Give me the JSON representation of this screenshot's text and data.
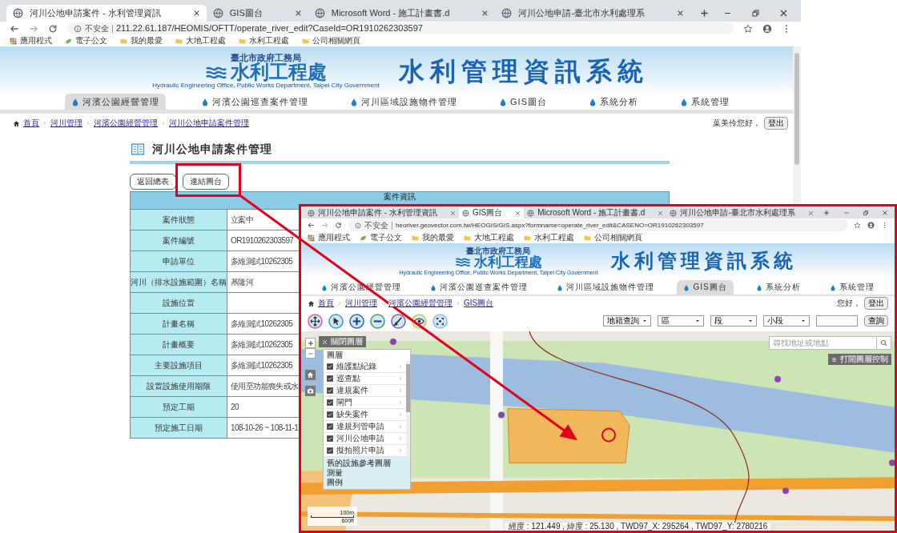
{
  "background_window": {
    "tabs": [
      {
        "title": "河川公地申請案件 - 水利管理資訊",
        "selected": true
      },
      {
        "title": "GIS圖台",
        "selected": false
      },
      {
        "title": "Microsoft Word - 施工計畫書.d",
        "selected": false
      },
      {
        "title": "河川公地申請-臺北市水利處理系",
        "selected": false
      }
    ],
    "address": {
      "security": "不安全",
      "url": "211.22.61.187/HEOMIS/OFTT/operate_river_edit?CaseId=OR1910262303597"
    },
    "bookmarks": [
      {
        "label": "應用程式",
        "kind": "apps"
      },
      {
        "label": "電子公文",
        "kind": "leaf"
      },
      {
        "label": "我的最愛",
        "kind": "folder"
      },
      {
        "label": "大地工程處",
        "kind": "folder"
      },
      {
        "label": "水利工程處",
        "kind": "folder"
      },
      {
        "label": "公司相關網頁",
        "kind": "folder"
      }
    ],
    "header": {
      "agency": "臺北市政府工務局",
      "office": "水利工程處",
      "office_en": "Hydraulic Engineering Office, Public Works Department, Taipei City Government",
      "system_title": "水利管理資訊系統"
    },
    "nav": [
      {
        "label": "河濱公園經營管理",
        "selected": true
      },
      {
        "label": "河濱公園巡查案件管理",
        "selected": false
      },
      {
        "label": "河川區域設施物件管理",
        "selected": false
      },
      {
        "label": "GIS圖台",
        "selected": false
      },
      {
        "label": "系統分析",
        "selected": false
      },
      {
        "label": "系統管理",
        "selected": false
      }
    ],
    "breadcrumb": [
      "首頁",
      "河川管理",
      "河濱公園經營管理",
      "河川公地申請案件管理"
    ],
    "user": {
      "greeting": "葉美伶您好，",
      "logout": "登出"
    },
    "page_title": "河川公地申請案件管理",
    "buttons": [
      "返回總表",
      "連結圖台"
    ],
    "case_table": {
      "heading": "案件資訊",
      "rows": [
        {
          "label": "案件狀態",
          "value": "立案中"
        },
        {
          "label": "案件編號",
          "value": "OR1910262303597"
        },
        {
          "label": "申請單位",
          "value": "多維測試10262305"
        },
        {
          "label": "河川（排水設施範圍）名稱",
          "value": "基隆河"
        },
        {
          "label": "設施位置",
          "value": ""
        },
        {
          "label": "計畫名稱",
          "value": "多維測試10262305"
        },
        {
          "label": "計畫概要",
          "value": "多維測試10262305"
        },
        {
          "label": "主要設施項目",
          "value": "多維測試10262305"
        },
        {
          "label": "設置設施使用期限",
          "value": "使用至功能喪失或水"
        },
        {
          "label": "預定工期",
          "value": "20"
        },
        {
          "label": "預定施工日期",
          "value": "108-10-26 ~ 108-11-1"
        }
      ]
    }
  },
  "gis_window": {
    "tabs": [
      {
        "title": "河川公地申請案件 - 水利管理資訊",
        "selected": false
      },
      {
        "title": "GIS圖台",
        "selected": true
      },
      {
        "title": "Microsoft Word - 施工計畫書.d",
        "selected": false
      },
      {
        "title": "河川公地申請-臺北市水利處理系",
        "selected": false
      }
    ],
    "address": {
      "security": "不安全",
      "url": "heoriver.geovector.com.tw/HEOGIS/GIS.aspx?formname=operate_river_edit&CASENO=OR1910262303597"
    },
    "bookmarks": [
      {
        "label": "應用程式",
        "kind": "apps"
      },
      {
        "label": "電子公文",
        "kind": "leaf"
      },
      {
        "label": "我的最愛",
        "kind": "folder"
      },
      {
        "label": "大地工程處",
        "kind": "folder"
      },
      {
        "label": "水利工程處",
        "kind": "folder"
      },
      {
        "label": "公司相關網頁",
        "kind": "folder"
      }
    ],
    "header": {
      "agency": "臺北市政府工務局",
      "office": "水利工程處",
      "office_en": "Hydraulic Engineering Office, Public Works Department, Taipei City Government",
      "system_title": "水利管理資訊系統"
    },
    "nav": [
      {
        "label": "河濱公園經營管理",
        "selected": false
      },
      {
        "label": "河濱公園巡查案件管理",
        "selected": false
      },
      {
        "label": "河川區域設施物件管理",
        "selected": false
      },
      {
        "label": "GIS圖台",
        "selected": true
      },
      {
        "label": "系統分析",
        "selected": false
      },
      {
        "label": "系統管理",
        "selected": false
      }
    ],
    "breadcrumb": [
      "首頁",
      "河川管理",
      "河濱公園經營管理",
      "GIS圖台"
    ],
    "user": {
      "greeting": "您好，",
      "logout": "登出"
    },
    "query": {
      "mode": "地籍查詢",
      "selects": [
        "區",
        "段",
        "小段"
      ],
      "button": "查詢"
    },
    "map": {
      "close_layers": "關閉圖層",
      "layers_heading": "圖層",
      "layers": [
        {
          "label": "維護點紀錄",
          "checked": true
        },
        {
          "label": "巡查點",
          "checked": true
        },
        {
          "label": "違規案件",
          "checked": true
        },
        {
          "label": "閘門",
          "checked": true
        },
        {
          "label": "缺失案件",
          "checked": true
        },
        {
          "label": "違規列管申請",
          "checked": true
        },
        {
          "label": "河川公地申請",
          "checked": true
        },
        {
          "label": "擬拍照片申請",
          "checked": true
        }
      ],
      "extra_items": [
        "舊的設施參考圖層",
        "測量",
        "圖例"
      ],
      "search_placeholder": "尋找地址或地點",
      "open_layers": "打開圖層控制",
      "scale": [
        "100m",
        "600ft"
      ],
      "coordinates": "經度 : 121.449 , 緯度 : 25.130 , TWD97_X: 295264 , TWD97_Y: 2780216"
    }
  }
}
